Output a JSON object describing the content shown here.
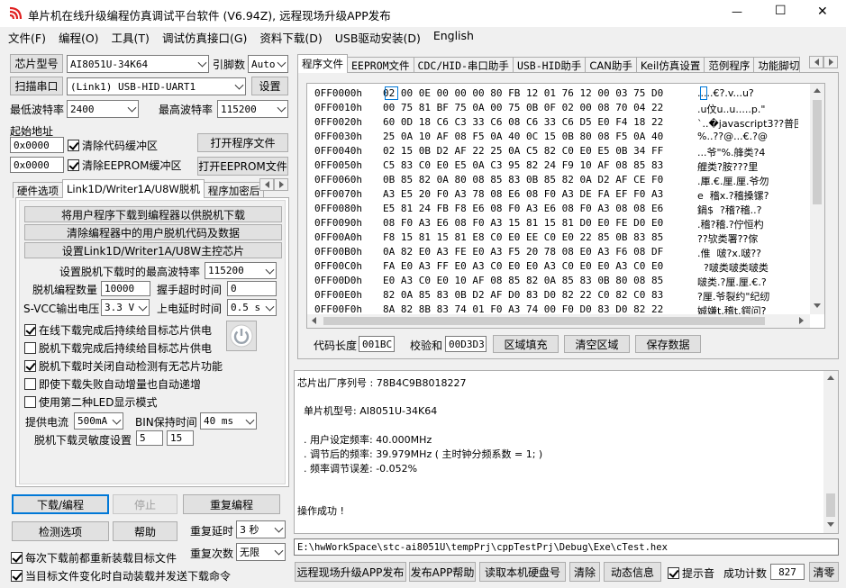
{
  "window": {
    "title": "单片机在线升级编程仿真调试平台软件 (V6.94Z), 远程现场升级APP发布",
    "minimize_glyph": "—",
    "maximize_glyph": "☐",
    "close_glyph": "✕"
  },
  "menu": [
    "文件(F)",
    "编程(O)",
    "工具(T)",
    "调试仿真接口(G)",
    "资料下载(D)",
    "USB驱动安装(D)",
    "English"
  ],
  "left": {
    "chip_type_btn": "芯片型号",
    "chip_type_value": "AI8051U-34K64",
    "pin_label": "引脚数",
    "pin_value": "Auto",
    "scan_port_btn": "扫描串口",
    "port_value": "(Link1) USB-HID-UART1",
    "settings_btn": "设置",
    "min_baud_label": "最低波特率",
    "min_baud_value": "2400",
    "max_baud_label": "最高波特率",
    "max_baud_value": "115200",
    "start_addr_label": "起始地址",
    "code_addr": "0x0000",
    "clear_code_label": "清除代码缓冲区",
    "open_prog_btn": "打开程序文件",
    "eeprom_addr": "0x0000",
    "clear_eeprom_label": "清除EEPROM缓冲区",
    "open_eeprom_btn": "打开EEPROM文件"
  },
  "left_tabs": [
    "硬件选项",
    "Link1D/Writer1A/U8W脱机",
    "程序加密后"
  ],
  "offline": {
    "btn1": "将用户程序下载到编程器以供脱机下载",
    "btn2": "清除编程器中的用户脱机代码及数据",
    "btn3": "设置Link1D/Writer1A/U8W主控芯片",
    "max_baud_label": "设置脱机下载时的最高波特率",
    "max_baud_value": "115200",
    "count_label": "脱机编程数量",
    "count_value": "10000",
    "handshake_label": "握手超时时间",
    "handshake_value": "0",
    "svcc_label": "S-VCC输出电压",
    "svcc_value": "3.3 V",
    "power_delay_label": "上电延时时间",
    "power_delay_value": "0.5 s",
    "cb1": "在线下载完成后持续给目标芯片供电",
    "cb2": "脱机下载完成后持续给目标芯片供电",
    "cb3": "脱机下载时关闭自动检测有无芯片功能",
    "cb4": "即使下载失败自动增量也自动递增",
    "cb5": "使用第二种LED显示模式",
    "current_label": "提供电流",
    "current_value": "500mA",
    "bin_label": "BIN保持时间",
    "bin_value": "40 ms",
    "sens_label": "脱机下载灵敏度设置",
    "sens_a": "5",
    "sens_b": "15"
  },
  "bottom_left": {
    "download_btn": "下载/编程",
    "stop_btn": "停止",
    "reprog_btn": "重复编程",
    "detect_btn": "检测选项",
    "help_btn": "帮助",
    "repeat_delay_label": "重复延时",
    "repeat_delay_value": "3 秒",
    "repeat_count_label": "重复次数",
    "repeat_count_value": "无限",
    "cb_reload": "每次下载前都重新装载目标文件",
    "cb_auto": "当目标文件变化时自动装载并发送下载命令"
  },
  "right_tabs": [
    "程序文件",
    "EEPROM文件",
    "CDC/HID-串口助手",
    "USB-HID助手",
    "CAN助手",
    "Keil仿真设置",
    "范例程序",
    "功能脚切"
  ],
  "hex": [
    {
      "addr": "0FF0000h",
      "bytes": "02 00 0E 00 00 00 80 FB 12 01 76 12 00 03 75 D0",
      "ascii": ".....€?.v...u?"
    },
    {
      "addr": "0FF0010h",
      "bytes": "00 75 81 BF 75 0A 00 75 0B 0F 02 00 08 70 04 22",
      "ascii": ".u伩u..u.....p.\""
    },
    {
      "addr": "0FF0020h",
      "bytes": "60 0D 18 C6 C3 33 C6 08 C6 33 C6 D5 E0 F4 18 22",
      "ascii": "`..�javascript3??普围.\""
    },
    {
      "addr": "0FF0030h",
      "bytes": "25 0A 10 AF 08 F5 0A 40 0C 15 0B 80 08 F5 0A 40",
      "ascii": "%..??@...€.?@"
    },
    {
      "addr": "0FF0040h",
      "bytes": "02 15 0B D2 AF 22 25 0A C5 82 C0 E0 E5 0B 34 FF",
      "ascii": "...爷\"%.艂类?4"
    },
    {
      "addr": "0FF0050h",
      "bytes": "C5 83 C0 E0 E5 0A C3 95 82 24 F9 10 AF 08 85 83",
      "ascii": "艃类?胺???里"
    },
    {
      "addr": "0FF0060h",
      "bytes": "0B 85 82 0A 80 08 85 83 0B 85 82 0A D2 AF CE F0",
      "ascii": ".厙.€.厘.厘.爷勿"
    },
    {
      "addr": "0FF0070h",
      "bytes": "A3 E5 20 F0 A3 78 08 E6 08 F0 A3 DE FA EF F0 A3",
      "ascii": "e  稽x.?稽搡镙?"
    },
    {
      "addr": "0FF0080h",
      "bytes": "E5 81 24 FB F8 E6 08 F0 A3 E6 08 F0 A3 08 08 E6",
      "ascii": "鍋$  ?稽?稽..?"
    },
    {
      "addr": "0FF0090h",
      "bytes": "08 F0 A3 E6 08 F0 A3 15 81 15 81 D0 E0 FE D0 E0",
      "ascii": ".稽?稽.?佇恒杓"
    },
    {
      "addr": "0FF00A0h",
      "bytes": "F8 15 81 15 81 E8 C0 E0 EE C0 E0 22 85 0B 83 85",
      "ascii": "??欤类署??傢"
    },
    {
      "addr": "0FF00B0h",
      "bytes": "0A 82 E0 A3 FE E0 A3 F5 20 78 08 E0 A3 F6 08 DF",
      "ascii": ".倠  啵?x.啵??"
    },
    {
      "addr": "0FF00C0h",
      "bytes": "FA E0 A3 FF E0 A3 C0 E0 E0 A3 C0 E0 E0 A3 C0 E0",
      "ascii": "  ?啵类啵类啵类"
    },
    {
      "addr": "0FF00D0h",
      "bytes": "E0 A3 C0 E0 10 AF 08 85 82 0A 85 83 0B 80 08 85",
      "ascii": "啵类.?厘.厘.€.?"
    },
    {
      "addr": "0FF00E0h",
      "bytes": "82 0A 85 83 0B D2 AF D0 83 D0 82 22 C0 82 C0 83",
      "ascii": "?厘.爷裂约\"纪纫"
    },
    {
      "addr": "0FF00F0h",
      "bytes": "8A 82 8B 83 74 01 F0 A3 74 00 F0 D0 83 D0 82 22",
      "ascii": "娍嫌t.稽t.鍔问?"
    }
  ],
  "code_bar": {
    "len_label": "代码长度",
    "len_value": "001BC",
    "sum_label": "校验和",
    "sum_value": "00D3D3",
    "fill_btn": "区域填充",
    "clear_btn": "清空区域",
    "save_btn": "保存数据"
  },
  "log": [
    "芯片出厂序列号 : 78B4C9B8018227",
    "",
    "  单片机型号: AI8051U-34K64",
    "",
    "  . 用户设定频率: 40.000MHz",
    "  . 调节后的频率: 39.979MHz ( 主时钟分频系数 = 1; )",
    "  . 频率调节误差: -0.052%",
    "",
    "",
    "操作成功 !"
  ],
  "file_path": "E:\\hwWorkSpace\\stc-ai8051U\\tempPrj\\cppTestPrj\\Debug\\Exe\\cTest.hex",
  "bottom_right": {
    "publish_btn": "远程现场升级APP发布",
    "publish_help_btn": "发布APP帮助",
    "read_disk_btn": "读取本机硬盘号",
    "clear_btn": "清除",
    "anim_btn": "动态信息",
    "beep_label": "提示音",
    "success_label": "成功计数",
    "success_value": "827",
    "reset_btn": "清零"
  },
  "colors": {
    "accent": "#0078d7",
    "logo": "#e02020"
  }
}
